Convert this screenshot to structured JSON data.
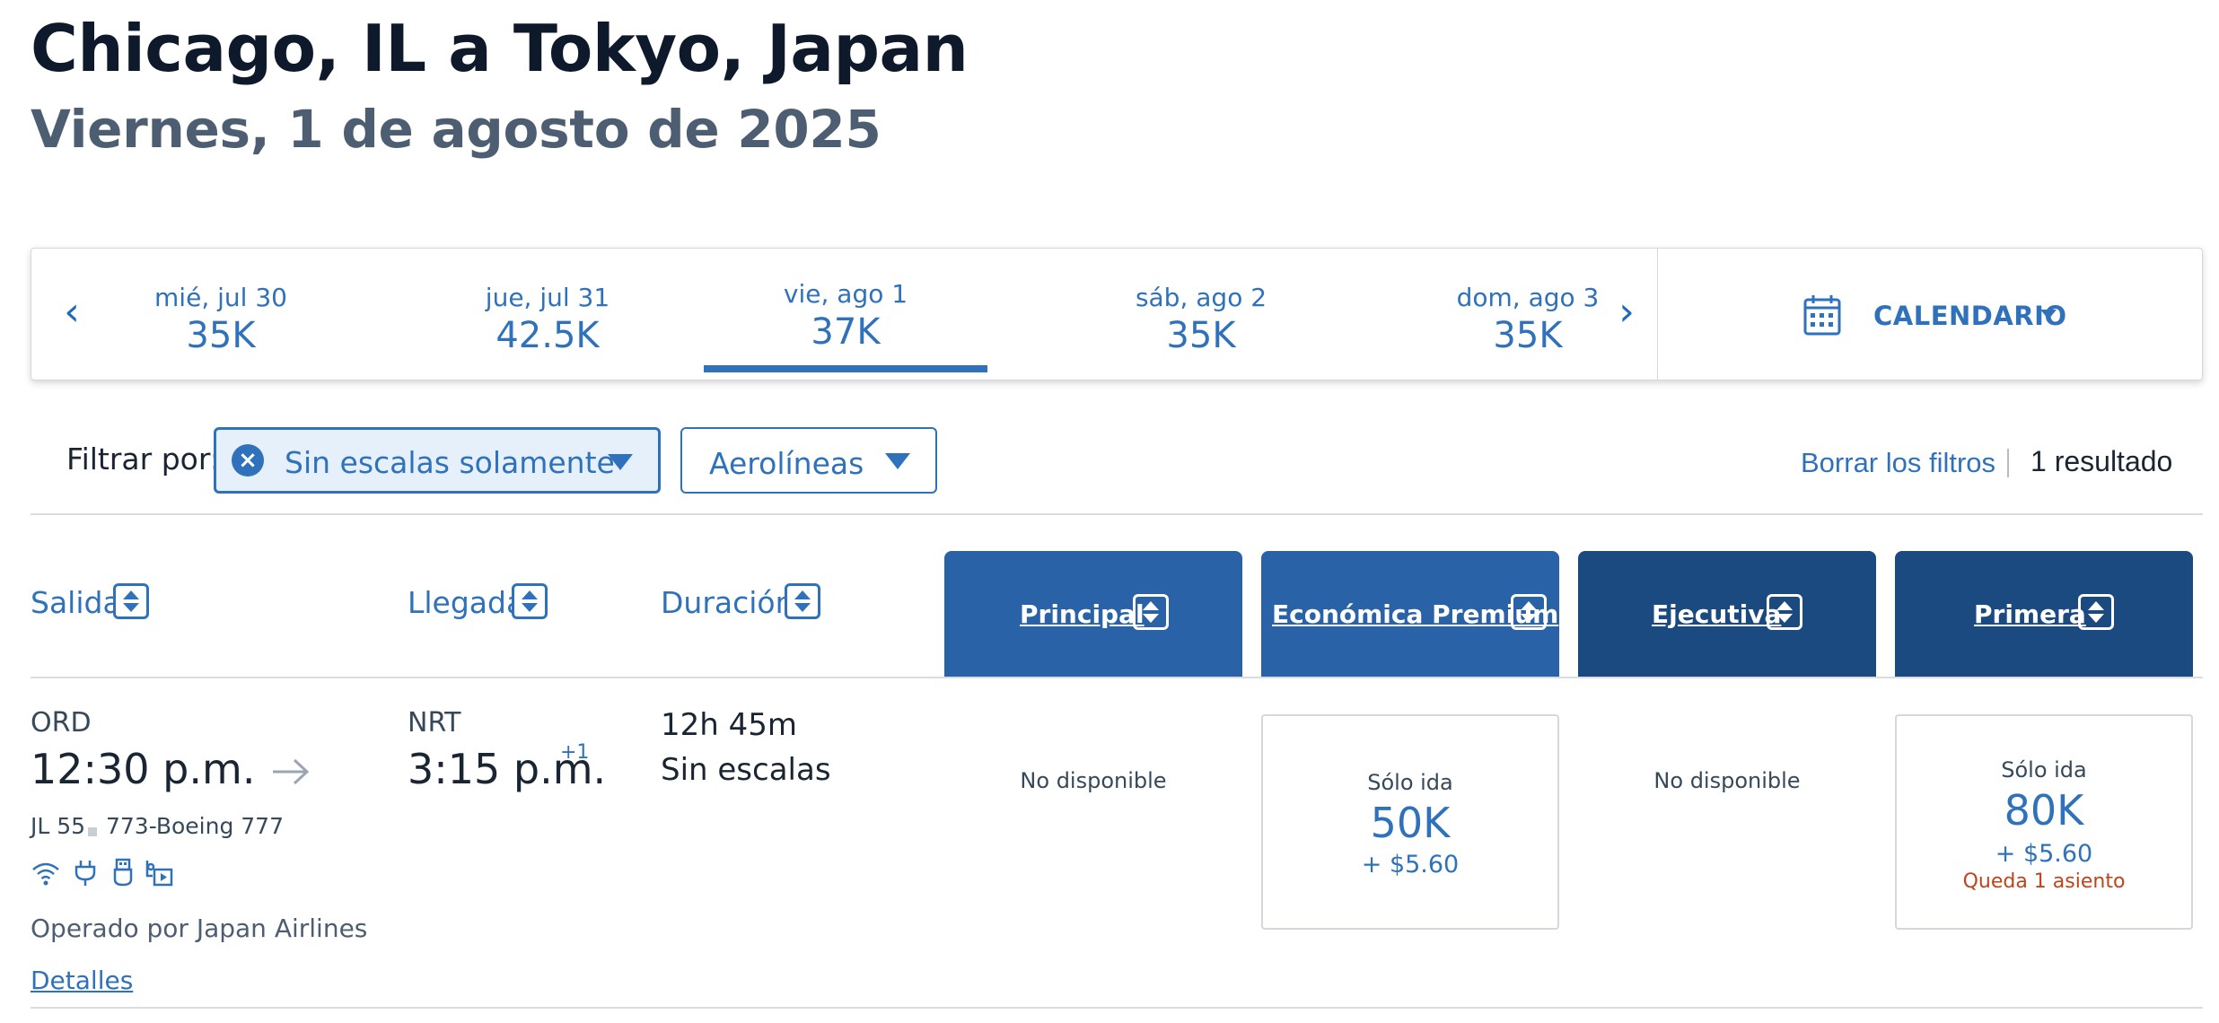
{
  "header": {
    "route": "Chicago, IL a Tokyo, Japan",
    "date": "Viernes, 1 de agosto de 2025"
  },
  "date_carousel": {
    "prev_icon": "chevron-left-icon",
    "next_icon": "chevron-right-icon",
    "dates": [
      {
        "label": "mié, jul 30",
        "price": "35K",
        "selected": false
      },
      {
        "label": "jue, jul 31",
        "price": "42.5K",
        "selected": false
      },
      {
        "label": "vie, ago 1",
        "price": "37K",
        "selected": true
      },
      {
        "label": "sáb, ago 2",
        "price": "35K",
        "selected": false
      },
      {
        "label": "dom, ago 3",
        "price": "35K",
        "selected": false
      }
    ],
    "calendar_label": "CALENDARIO",
    "calendar_icon": "calendar-icon"
  },
  "filters": {
    "label": "Filtrar por:",
    "active_chip": "Sin escalas solamente",
    "airlines_dropdown": "Aerolíneas",
    "clear_label": "Borrar los filtros",
    "result_count": "1 resultado"
  },
  "columns": {
    "departure": "Salida",
    "arrival": "Llegada",
    "duration": "Duración",
    "cabins": [
      {
        "name": "Principal",
        "color": "#2a62a8"
      },
      {
        "name": "Económica Premium",
        "color": "#2a62a8"
      },
      {
        "name": "Ejecutiva",
        "color": "#1b4a80"
      },
      {
        "name": "Primera",
        "color": "#1b4a80"
      }
    ]
  },
  "flight": {
    "origin": "ORD",
    "depart_time": "12:30 p.m.",
    "destination": "NRT",
    "arrive_time": "3:15 p.m.",
    "day_offset": "+1",
    "flight_number": "JL 55",
    "aircraft": "773-Boeing 777",
    "amenities": [
      "wifi-icon",
      "power-plug-icon",
      "usb-icon",
      "entertainment-icon"
    ],
    "operated_by": "Operado por Japan Airlines",
    "details_label": "Detalles",
    "duration": "12h 45m",
    "stops": "Sin escalas",
    "fares": {
      "main": {
        "unavailable": "No disponible"
      },
      "premium": {
        "type": "Sólo ida",
        "miles": "50K",
        "tax": "+ $5.60"
      },
      "business": {
        "unavailable": "No disponible"
      },
      "first": {
        "type": "Sólo ida",
        "miles": "80K",
        "tax": "+ $5.60",
        "seats": "Queda 1 asiento"
      }
    }
  },
  "colors": {
    "accent": "#2f72bb",
    "seat_warning": "#c0441a"
  }
}
